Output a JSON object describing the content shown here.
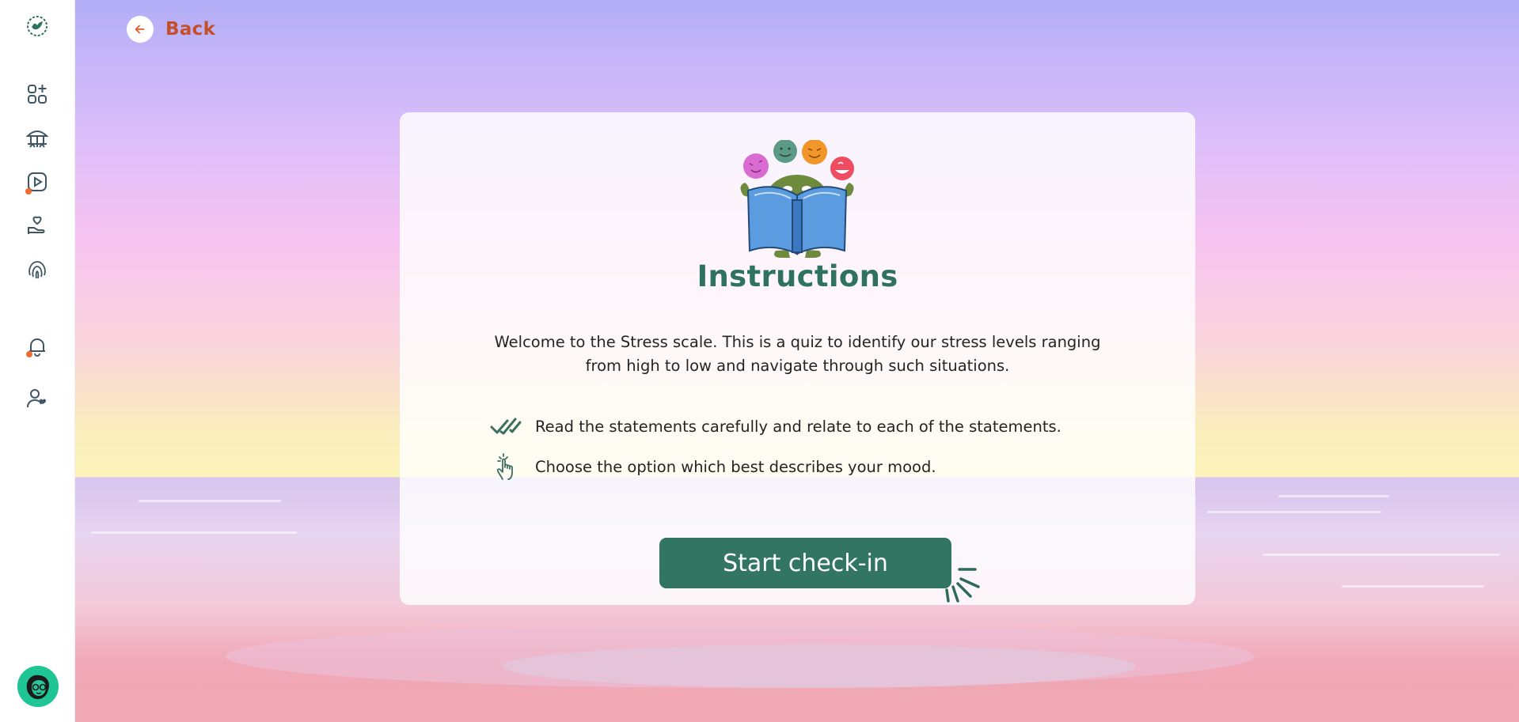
{
  "sidebar": {
    "items": [
      {
        "icon": "logo-icon"
      },
      {
        "icon": "dashboard-icon"
      },
      {
        "icon": "community-icon"
      },
      {
        "icon": "video-icon",
        "badge": true
      },
      {
        "icon": "care-icon"
      },
      {
        "icon": "fingerprint-icon"
      },
      {
        "icon": "bell-icon",
        "badge": true
      },
      {
        "icon": "profile-icon"
      }
    ],
    "avatar": "avatar"
  },
  "header": {
    "back_label": "Back"
  },
  "card": {
    "title": "Instructions",
    "intro": "Welcome to the Stress scale. This is a quiz to identify our stress levels ranging from high to low and navigate through such situations.",
    "rules": [
      {
        "icon": "double-check-icon",
        "text": "Read the statements carefully and relate to each of the statements."
      },
      {
        "icon": "tap-hand-icon",
        "text": "Choose the option which best describes your mood."
      }
    ],
    "cta_label": "Start check-in"
  },
  "colors": {
    "accent_green": "#327562",
    "title_green": "#2f7260",
    "back_orange": "#c4502b",
    "badge_orange": "#f26a2e"
  }
}
